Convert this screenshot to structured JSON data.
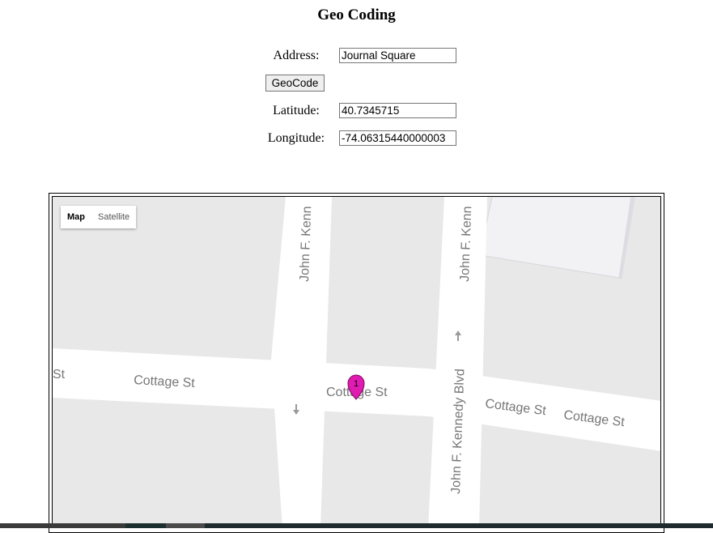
{
  "page": {
    "title": "Geo Coding"
  },
  "form": {
    "address_label": "Address:",
    "address_value": "Journal Square",
    "geocode_button": "GeoCode",
    "latitude_label": "Latitude:",
    "latitude_value": "40.7345715",
    "longitude_label": "Longitude:",
    "longitude_value": "-74.06315440000003"
  },
  "map": {
    "type_controls": {
      "map": "Map",
      "satellite": "Satellite",
      "selected": "Map"
    },
    "streets": {
      "jfk_vertical_left": "John F. Kenn",
      "jfk_vertical_right": "John F. Kenn",
      "jfk_blvd": "John F. Kennedy Blvd",
      "cottage_st": "Cottage St",
      "cottage_st_partial": "St"
    },
    "marker": {
      "label": "1",
      "color": "#e01bb1",
      "icon": "map-pin-icon"
    },
    "colors": {
      "land": "#e8e8e8",
      "road": "#ffffff",
      "building": "#f1f1f3"
    }
  }
}
